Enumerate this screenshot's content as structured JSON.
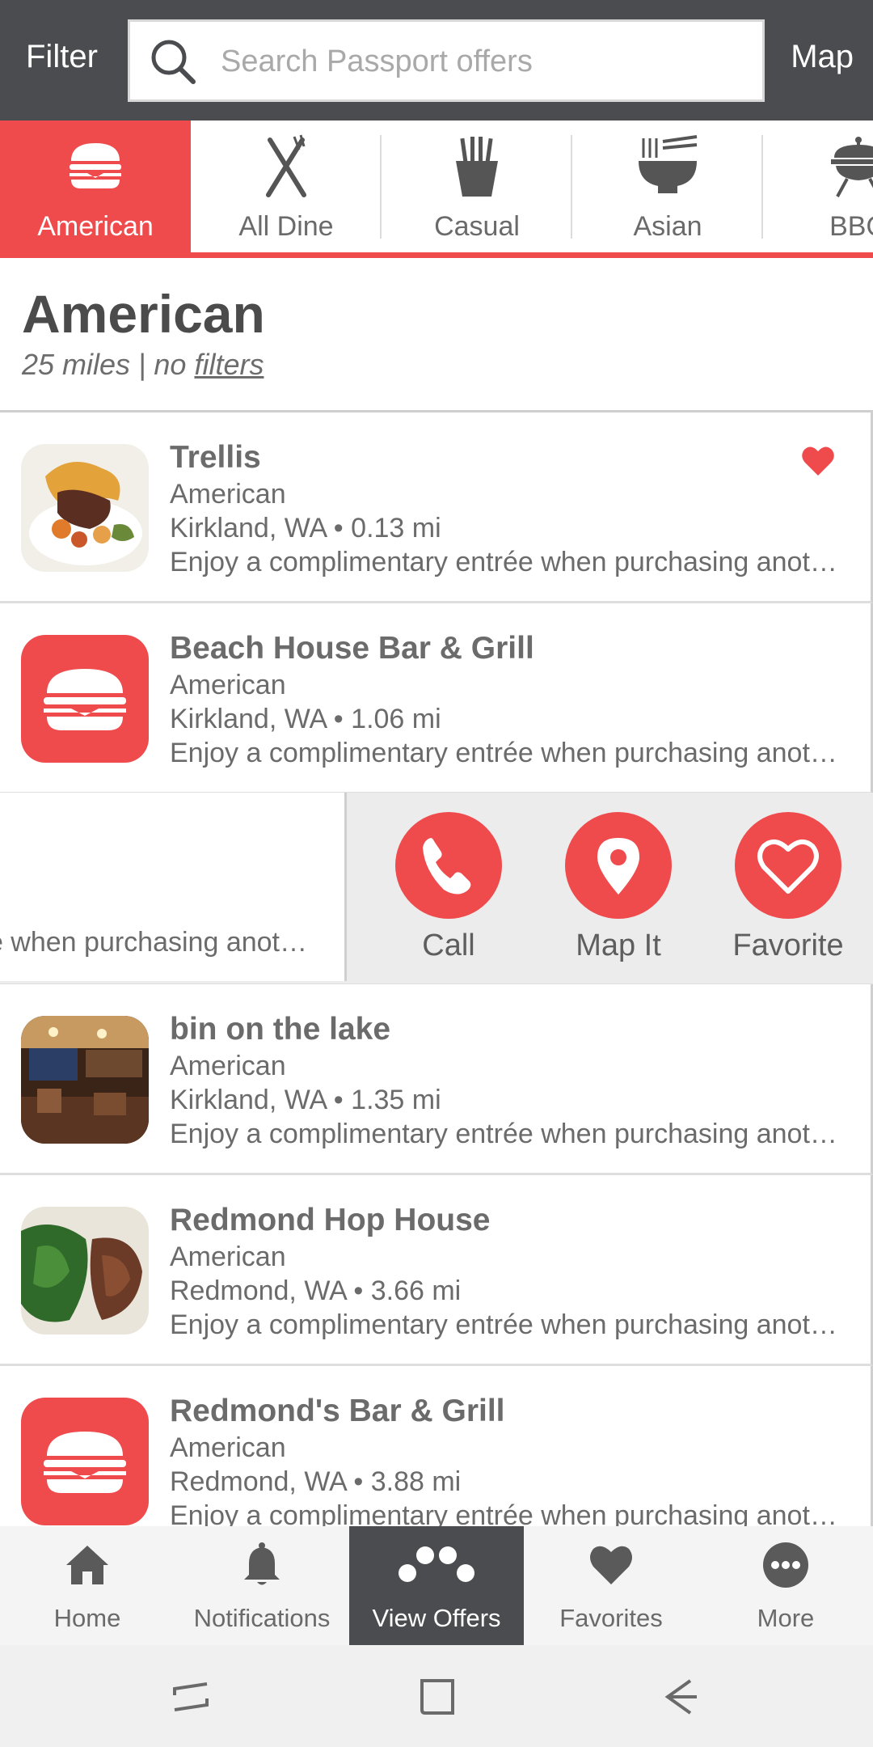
{
  "topbar": {
    "filter_label": "Filter",
    "search_placeholder": "Search Passport offers",
    "map_label": "Map"
  },
  "categories": [
    {
      "label": "American",
      "icon": "burger-icon",
      "active": true
    },
    {
      "label": "All Dine",
      "icon": "fork-knife-icon",
      "active": false
    },
    {
      "label": "Casual",
      "icon": "fries-icon",
      "active": false
    },
    {
      "label": "Asian",
      "icon": "noodle-bowl-icon",
      "active": false
    },
    {
      "label": "BBQ",
      "icon": "grill-icon",
      "active": false
    }
  ],
  "heading": {
    "title": "American",
    "subtitle_prefix": "25 miles | no ",
    "subtitle_link": "filters"
  },
  "restaurants": [
    {
      "name": "Trellis",
      "category": "American",
      "location": "Kirkland, WA • 0.13 mi",
      "offer": "Enjoy a complimentary entrée when purchasing another entrée of equal or greater value",
      "thumb": "photo-food",
      "favorited": true
    },
    {
      "name": "Beach House Bar & Grill",
      "category": "American",
      "location": "Kirkland, WA • 1.06 mi",
      "offer": "Enjoy a complimentary entrée when purchasing another entrée of equal or greater value",
      "thumb": "burger-icon",
      "favorited": false
    },
    {
      "name": "bin on the lake",
      "category": "American",
      "location": "Kirkland, WA • 1.35 mi",
      "offer": "Enjoy a complimentary entrée when purchasing another entrée of equal or greater value",
      "thumb": "photo-interior",
      "favorited": false
    },
    {
      "name": "Redmond Hop House",
      "category": "American",
      "location": "Redmond, WA • 3.66 mi",
      "offer": "Enjoy a complimentary entrée when purchasing another entrée of equal or greater value",
      "thumb": "photo-food",
      "favorited": false
    },
    {
      "name": "Redmond's Bar & Grill",
      "category": "American",
      "location": "Redmond, WA • 3.88 mi",
      "offer": "Enjoy a complimentary entrée when purchasing another entrée of equal or greater value",
      "thumb": "burger-icon",
      "favorited": false
    }
  ],
  "swiped_row": {
    "offer_fragment": "e when purchasing anot…",
    "actions": [
      {
        "label": "Call",
        "icon": "phone-icon"
      },
      {
        "label": "Map It",
        "icon": "map-pin-icon"
      },
      {
        "label": "Favorite",
        "icon": "heart-outline-icon"
      }
    ]
  },
  "bottom_nav": [
    {
      "label": "Home",
      "icon": "home-icon",
      "active": false
    },
    {
      "label": "Notifications",
      "icon": "bell-icon",
      "active": false
    },
    {
      "label": "View Offers",
      "icon": "offers-dots-icon",
      "active": true
    },
    {
      "label": "Favorites",
      "icon": "heart-icon",
      "active": false
    },
    {
      "label": "More",
      "icon": "more-icon",
      "active": false
    }
  ],
  "colors": {
    "accent": "#ef4b4d",
    "topbar": "#4a4c4f",
    "text": "#6b6b6b"
  }
}
